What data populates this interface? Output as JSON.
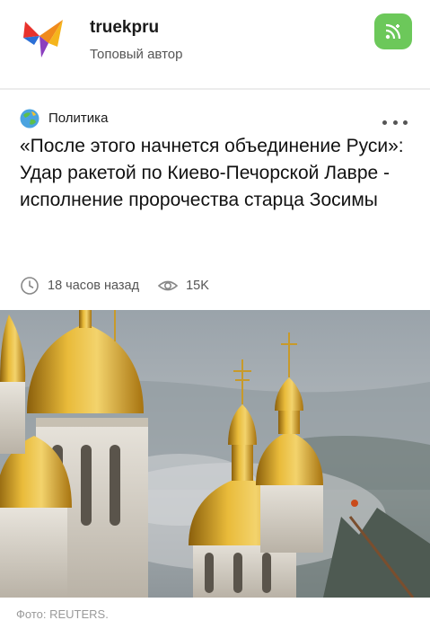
{
  "author": {
    "name": "truekpru",
    "status": "Топовый автор"
  },
  "post": {
    "category": "Политика",
    "headline": "«После этого начнется объединение Руси»: Удар ракетой по Киево-Печорской Лавре - исполнение пророчества старца Зосимы",
    "time_ago": "18 часов назад",
    "views": "15K"
  },
  "photo": {
    "caption": "Фото: REUTERS."
  },
  "icons": {
    "logo": "bird-logo-icon",
    "subscribe": "subscribe-icon",
    "category": "globe-icon",
    "more": "more-dots-icon",
    "time": "clock-icon",
    "views": "eye-icon"
  },
  "colors": {
    "subscribe_bg": "#6cc85a",
    "dome_gold": "#d6a21e",
    "sky": "#a9b0b5"
  }
}
